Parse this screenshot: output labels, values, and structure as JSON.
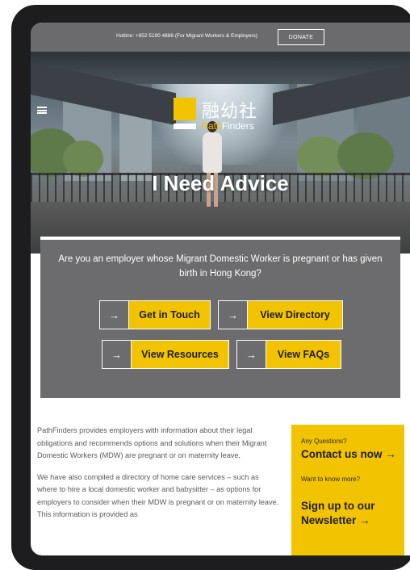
{
  "topbar": {
    "hotline": "Hotline: +852 5190 4886 (For Migrant Workers & Employers)",
    "donate_label": "DONATE"
  },
  "logo": {
    "chinese": "融幼社",
    "english_part1": "Path",
    "english_part2": "Finders"
  },
  "hero": {
    "title": "I Need Advice"
  },
  "advice": {
    "question": "Are you an employer whose Migrant Domestic Worker is pregnant or has given birth in Hong Kong?",
    "buttons": [
      {
        "label": "Get in Touch",
        "icon": "arrow-right-icon"
      },
      {
        "label": "View Directory",
        "icon": "arrow-right-icon"
      },
      {
        "label": "View Resources",
        "icon": "arrow-right-icon"
      },
      {
        "label": "View FAQs",
        "icon": "arrow-right-icon"
      }
    ],
    "arrow_glyph": "→"
  },
  "content": {
    "paragraph1": "PathFinders provides employers with information about their legal obligations and recommends options and solutions when their Migrant Domestic Workers (MDW) are pregnant or on maternity leave.",
    "paragraph2": "We have also compiled a directory of home care services – such as where to hire a local domestic worker and babysitter – as options for employers to consider when their MDW is pregnant or on maternity leave. This information is provided as"
  },
  "sidebar": {
    "questions_label": "Any Questions?",
    "contact_link": "Contact us now →",
    "know_more_label": "Want to know more?",
    "newsletter_line1": "Sign up to our",
    "newsletter_line2": "Newsletter →"
  },
  "colors": {
    "brand_yellow": "#f2c300",
    "panel_gray": "#6c6b6d",
    "topbar_gray": "#6b6b6d"
  }
}
